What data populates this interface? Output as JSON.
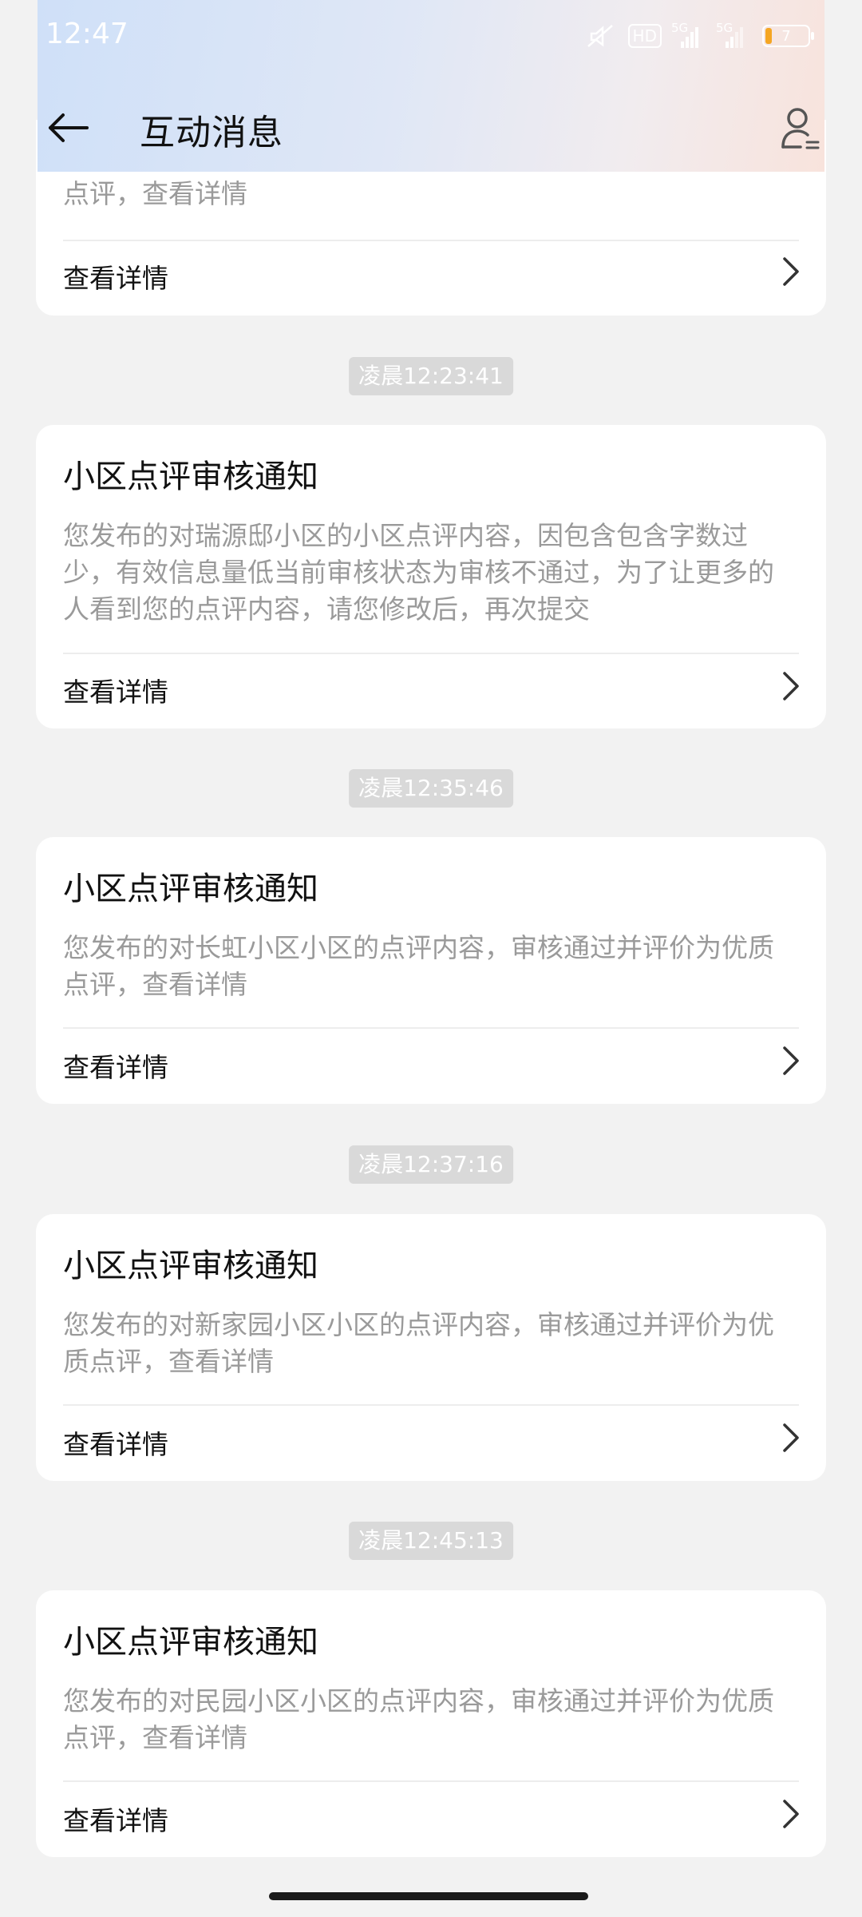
{
  "status_bar": {
    "time": "12:47",
    "battery": "7",
    "signal_label": "5G",
    "hd_label": "HD"
  },
  "header": {
    "title": "互动消息",
    "back_icon": "arrow-left-icon",
    "profile_icon": "user-list-icon"
  },
  "detail_label": "查看详情",
  "top_partial": {
    "body": "点评，查看详情"
  },
  "messages": [
    {
      "time": "凌晨12:23:41",
      "title": "小区点评审核通知",
      "body": "您发布的对瑞源邸小区的小区点评内容，因包含包含字数过少，有效信息量低当前审核状态为审核不通过，为了让更多的人看到您的点评内容，请您修改后，再次提交"
    },
    {
      "time": "凌晨12:35:46",
      "title": "小区点评审核通知",
      "body": "您发布的对长虹小区小区的点评内容，审核通过并评价为优质点评，查看详情"
    },
    {
      "time": "凌晨12:37:16",
      "title": "小区点评审核通知",
      "body": "您发布的对新家园小区小区的点评内容，审核通过并评价为优质点评，查看详情"
    },
    {
      "time": "凌晨12:45:13",
      "title": "小区点评审核通知",
      "body": "您发布的对民园小区小区的点评内容，审核通过并评价为优质点评，查看详情"
    }
  ]
}
